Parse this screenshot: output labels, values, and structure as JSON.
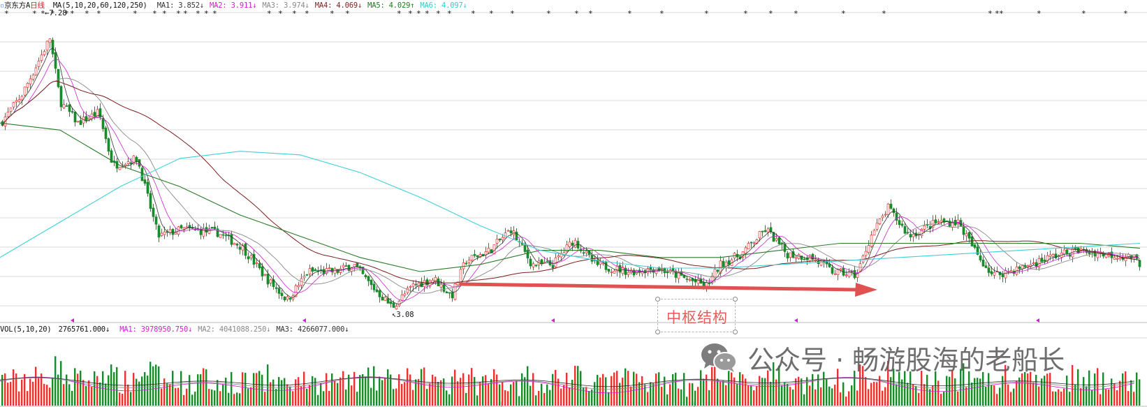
{
  "stock": {
    "name": "京东方A",
    "period": "日线"
  },
  "price_header": {
    "ma_def": "MA(5,10,20,60,120,250)",
    "items": [
      {
        "label": "MA1: 3.852",
        "arrow": "↓",
        "color": "#333333"
      },
      {
        "label": "MA2: 3.911",
        "arrow": "↓",
        "color": "#cc22cc"
      },
      {
        "label": "MA3: 3.974",
        "arrow": "↓",
        "color": "#888888"
      },
      {
        "label": "MA4: 4.069",
        "arrow": "↓",
        "color": "#7a1f1f"
      },
      {
        "label": "MA5: 4.029",
        "arrow": "↑",
        "color": "#1f7a1f"
      },
      {
        "label": "MA6: 4.097",
        "arrow": "↓",
        "color": "#33cccc"
      }
    ]
  },
  "volume_header": {
    "def": "VOL(5,10,20)",
    "value": "2765761.000",
    "value_arrow": "↓",
    "items": [
      {
        "label": "MA1: 3978950.750",
        "arrow": "↓",
        "color": "#cc22cc"
      },
      {
        "label": "MA2: 4041088.250",
        "arrow": "↓",
        "color": "#888888"
      },
      {
        "label": "MA3: 4266077.000",
        "arrow": "↓",
        "color": "#333333"
      }
    ]
  },
  "price_labels": {
    "high": "7.28",
    "low": "3.08"
  },
  "annotation": {
    "text": "中枢结构"
  },
  "watermark": {
    "text": "公众号 · 畅游股海的老船长"
  },
  "colors": {
    "up": "#e8332f",
    "down": "#1a8a2a",
    "arrow": "#e05252",
    "grid": "#d9d9d9"
  },
  "chart_data": {
    "type": "line",
    "title": "京东方A 日线",
    "series": [
      {
        "name": "MA6",
        "values": [
          3.9,
          4.4,
          4.9,
          5.3,
          5.4,
          5.35,
          5.1,
          4.75,
          4.35,
          4.0,
          3.85,
          3.75,
          3.75,
          3.8,
          3.85,
          3.9,
          3.95,
          4.0,
          4.05,
          4.1
        ]
      },
      {
        "name": "MA5",
        "values": [
          5.8,
          5.7,
          5.2,
          4.9,
          4.5,
          4.2,
          3.9,
          3.7,
          3.8,
          4.0,
          4.0,
          3.9,
          3.9,
          4.0,
          4.1,
          4.1,
          4.1,
          4.1,
          4.1,
          4.03
        ]
      }
    ],
    "ylim": [
      3.0,
      7.4
    ],
    "grid": true,
    "price_high": 7.28,
    "price_low": 3.08
  }
}
